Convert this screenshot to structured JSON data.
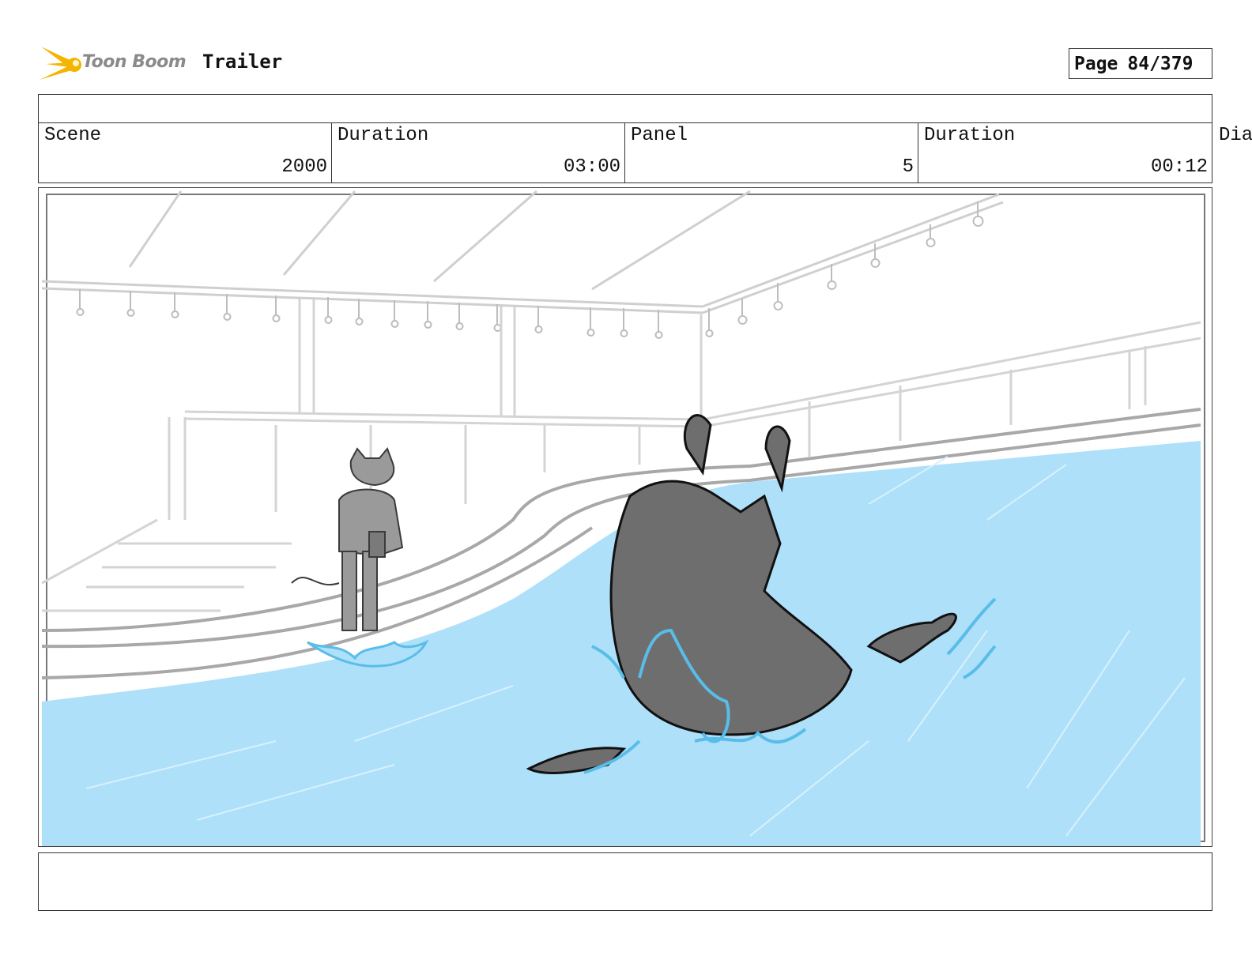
{
  "header": {
    "logo_text": "Toon Boom",
    "project_title": "Trailer",
    "page_label": "Page",
    "page_number": "84/379"
  },
  "info": {
    "scene_label": "Scene",
    "scene_value": "2000",
    "scene_duration_label": "Duration",
    "scene_duration_value": "03:00",
    "panel_label": "Panel",
    "panel_value": "5",
    "panel_duration_label": "Duration",
    "panel_duration_value": "00:12",
    "overflow_label": "Dia"
  },
  "colors": {
    "water": "#aee0fa",
    "splash": "#58bde8",
    "character": "#6e6e6e",
    "logo_flare": "#f5b400"
  }
}
